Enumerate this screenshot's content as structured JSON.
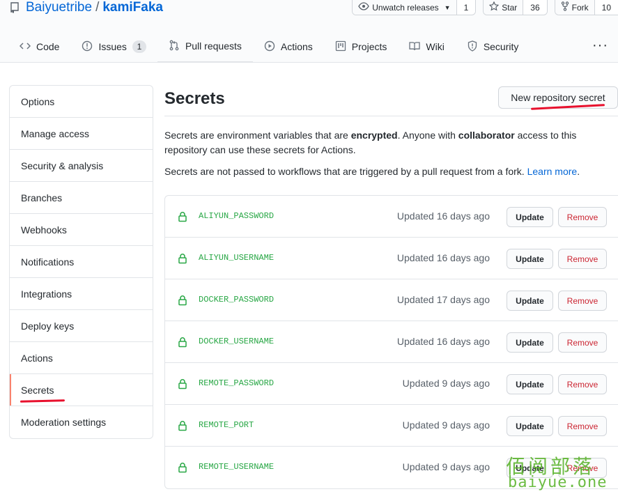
{
  "repo": {
    "owner": "Baiyuetribe",
    "separator": "/",
    "name": "kamiFaka"
  },
  "header_actions": [
    {
      "label": "Unwatch releases",
      "count": "1",
      "icon": "eye-icon"
    },
    {
      "label": "Star",
      "count": "36",
      "icon": "star-icon"
    },
    {
      "label": "Fork",
      "count": "10",
      "icon": "fork-icon"
    }
  ],
  "tabs": [
    {
      "label": "Code",
      "icon": "code-icon"
    },
    {
      "label": "Issues",
      "icon": "issue-icon",
      "counter": "1"
    },
    {
      "label": "Pull requests",
      "icon": "pull-request-icon"
    },
    {
      "label": "Actions",
      "icon": "play-icon"
    },
    {
      "label": "Projects",
      "icon": "project-icon"
    },
    {
      "label": "Wiki",
      "icon": "book-icon"
    },
    {
      "label": "Security",
      "icon": "shield-icon"
    }
  ],
  "more_label": "···",
  "sidebar": {
    "items": [
      {
        "label": "Options"
      },
      {
        "label": "Manage access"
      },
      {
        "label": "Security & analysis"
      },
      {
        "label": "Branches"
      },
      {
        "label": "Webhooks"
      },
      {
        "label": "Notifications"
      },
      {
        "label": "Integrations"
      },
      {
        "label": "Deploy keys"
      },
      {
        "label": "Actions"
      },
      {
        "label": "Secrets",
        "selected": true
      },
      {
        "label": "Moderation settings"
      }
    ]
  },
  "main": {
    "title": "Secrets",
    "new_button": "New repository secret",
    "desc1_parts": [
      "Secrets are environment variables that are ",
      "encrypted",
      ". Anyone with ",
      "collaborator",
      " access to this repository can use these secrets for Actions."
    ],
    "desc2": "Secrets are not passed to workflows that are triggered by a pull request from a fork.",
    "learn_more": "Learn more",
    "desc2_end": "."
  },
  "secrets": [
    {
      "name": "ALIYUN_PASSWORD",
      "updated": "Updated 16 days ago",
      "update_label": "Update",
      "remove_label": "Remove"
    },
    {
      "name": "ALIYUN_USERNAME",
      "updated": "Updated 16 days ago",
      "update_label": "Update",
      "remove_label": "Remove"
    },
    {
      "name": "DOCKER_PASSWORD",
      "updated": "Updated 17 days ago",
      "update_label": "Update",
      "remove_label": "Remove"
    },
    {
      "name": "DOCKER_USERNAME",
      "updated": "Updated 16 days ago",
      "update_label": "Update",
      "remove_label": "Remove"
    },
    {
      "name": "REMOTE_PASSWORD",
      "updated": "Updated 9 days ago",
      "update_label": "Update",
      "remove_label": "Remove"
    },
    {
      "name": "REMOTE_PORT",
      "updated": "Updated 9 days ago",
      "update_label": "Update",
      "remove_label": "Remove"
    },
    {
      "name": "REMOTE_USERNAME",
      "updated": "Updated 9 days ago",
      "update_label": "Update",
      "remove_label": "Remove"
    }
  ],
  "watermark": {
    "cn": "佰阅部落",
    "en": "baiyue.one"
  },
  "colors": {
    "link": "#0366d6",
    "secret_name": "#28a745",
    "remove": "#cb2431",
    "annotation": "#e8102d",
    "watermark": "#5db52f"
  }
}
